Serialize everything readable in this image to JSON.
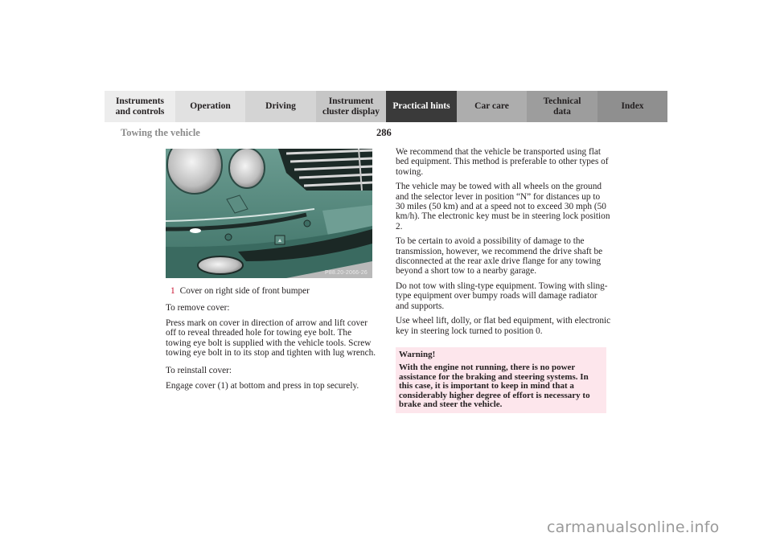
{
  "nav": {
    "tabs": [
      {
        "label": "Instruments\nand controls",
        "active": false
      },
      {
        "label": "Operation",
        "active": false
      },
      {
        "label": "Driving",
        "active": false
      },
      {
        "label": "Instrument\ncluster display",
        "active": false
      },
      {
        "label": "Practical hints",
        "active": true
      },
      {
        "label": "Car care",
        "active": false
      },
      {
        "label": "Technical\ndata",
        "active": false
      },
      {
        "label": "Index",
        "active": false
      }
    ]
  },
  "header": {
    "section_title": "Towing the vehicle",
    "page_number": "286"
  },
  "figure": {
    "code": "P88.20-2066-26",
    "callout": "1",
    "caption_number": "1",
    "caption_text": "Cover on right side of front bumper"
  },
  "left_column": {
    "remove_heading": "To remove cover:",
    "remove_text": "Press mark on cover in direction of arrow and lift cover off to reveal threaded hole for towing eye bolt. The towing eye bolt is supplied with the vehicle tools. Screw towing eye bolt in to its stop and tighten with lug wrench.",
    "reinstall_heading": "To reinstall cover:",
    "reinstall_text": "Engage cover (1) at bottom and press in top securely."
  },
  "right_column": {
    "paragraphs": [
      "We recommend that the vehicle be transported using flat bed equipment. This method is preferable to other types of towing.",
      "The vehicle may be towed with all wheels on the ground and the selector lever in position “N” for distances up to 30 miles (50 km) and at a speed not to exceed 30 mph (50 km/h). The electronic key must be in steering lock position 2.",
      "To be certain to avoid a possibility of damage to the transmission, however, we recommend the drive shaft be disconnected at the rear axle drive flange for any towing beyond a short tow to a nearby garage.",
      "Do not tow with sling-type equipment. Towing with sling-type equipment over bumpy roads will damage radiator and supports.",
      "Use wheel lift, dolly, or flat bed equipment, with electronic key in steering lock turned to position 0."
    ]
  },
  "warning": {
    "title": "Warning!",
    "text": "With the engine not running, there is no power assistance for the braking and steering systems. In this case, it is important to keep in mind that a considerably higher degree of effort is necessary to brake and steer the vehicle."
  },
  "watermark": "carmanualsonline.info",
  "colors": {
    "active_tab": "#3a3a3a",
    "accent_red": "#c8102e",
    "warning_bg": "#fde6ec",
    "car_paint": "#4f857a"
  }
}
